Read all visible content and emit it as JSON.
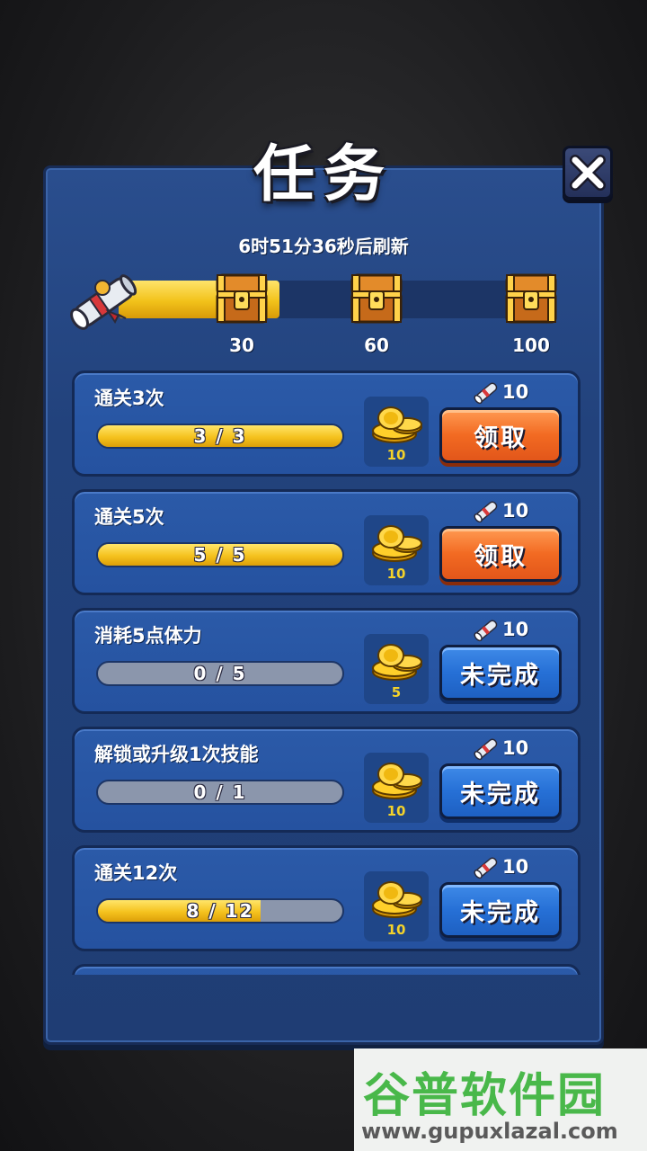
{
  "title": "任务",
  "refresh_text": "6时51分36秒后刷新",
  "milestone_progress": 0.38,
  "milestones": [
    {
      "label": "30",
      "icon": "treasure-chest-icon"
    },
    {
      "label": "60",
      "icon": "treasure-chest-icon"
    },
    {
      "label": "100",
      "icon": "treasure-chest-icon"
    }
  ],
  "tasks": [
    {
      "title": "通关3次",
      "progress_text": "3 / 3",
      "progress": 1.0,
      "coins": "10",
      "reward": "10",
      "button": "领取",
      "status": "claim"
    },
    {
      "title": "通关5次",
      "progress_text": "5 / 5",
      "progress": 1.0,
      "coins": "10",
      "reward": "10",
      "button": "领取",
      "status": "claim"
    },
    {
      "title": "消耗5点体力",
      "progress_text": "0 / 5",
      "progress": 0.0,
      "coins": "5",
      "reward": "10",
      "button": "未完成",
      "status": "incomplete"
    },
    {
      "title": "解锁或升级1次技能",
      "progress_text": "0 / 1",
      "progress": 0.0,
      "coins": "10",
      "reward": "10",
      "button": "未完成",
      "status": "incomplete"
    },
    {
      "title": "通关12次",
      "progress_text": "8 / 12",
      "progress": 0.6667,
      "coins": "10",
      "reward": "10",
      "button": "未完成",
      "status": "incomplete"
    }
  ],
  "watermark": {
    "name": "谷普软件园",
    "url": "www.gupuxlazal.com"
  },
  "colors": {
    "claim_button": "#f26a22",
    "incomplete_button": "#2670d6",
    "progress_fill": "#f5c21e",
    "panel": "#22427c"
  }
}
